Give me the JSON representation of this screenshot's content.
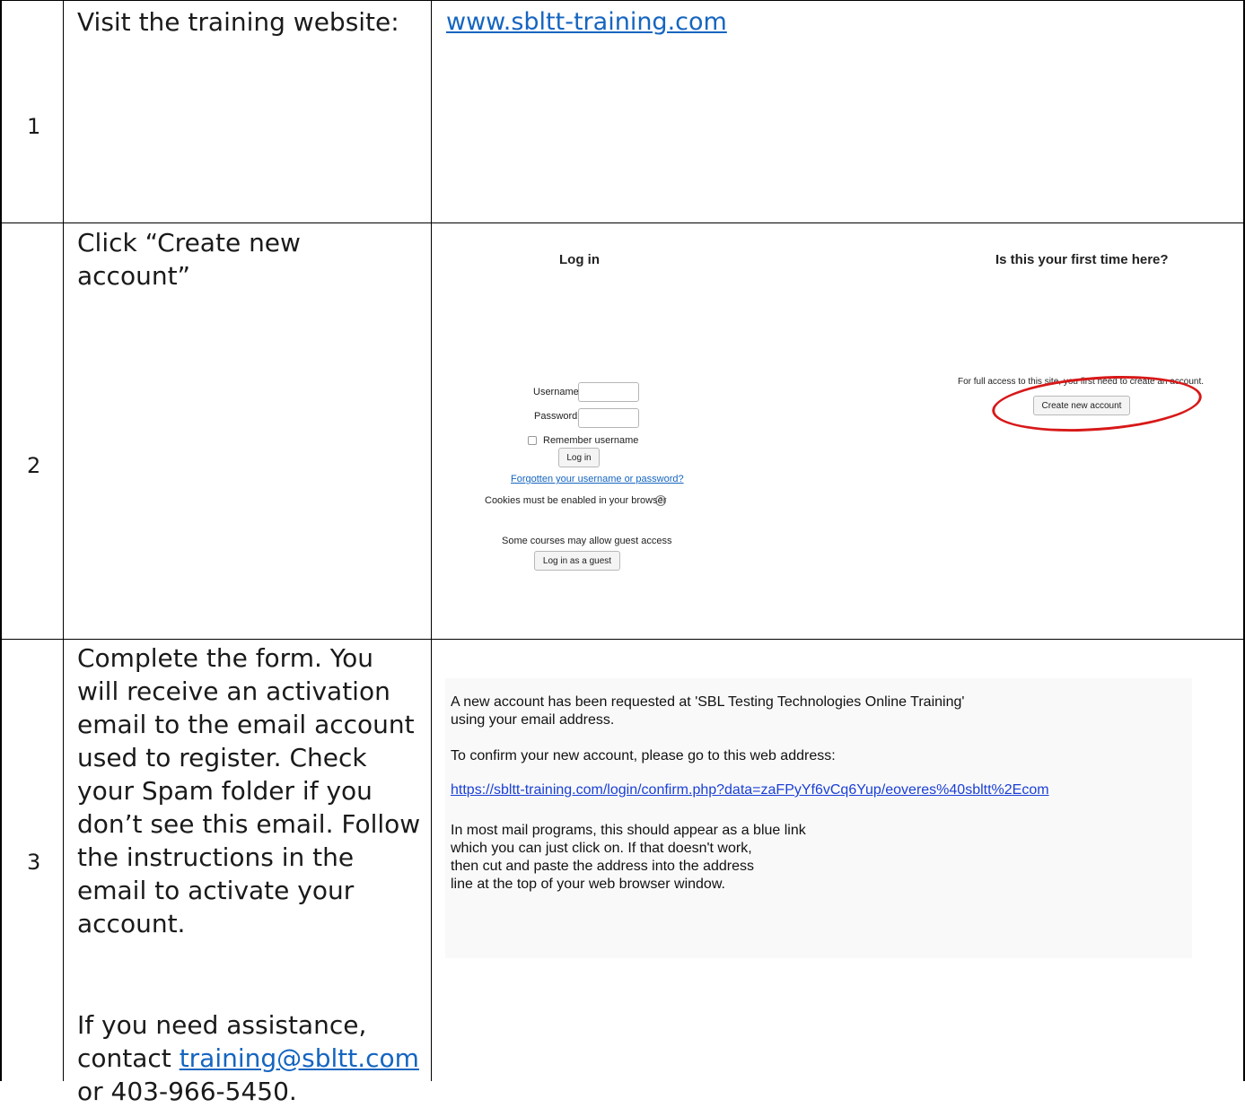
{
  "rows": [
    {
      "number": "1",
      "instruction": "Visit the training website:",
      "link": "www.sbltt-training.com"
    },
    {
      "number": "2",
      "instruction": "Click “Create new account”",
      "screenshot": {
        "login_title": "Log in",
        "username_label": "Username",
        "password_label": "Password",
        "remember_label": "Remember username",
        "login_button": "Log in",
        "forgot_link": "Forgotten your username or password?",
        "cookies_text": "Cookies must be enabled in your browser",
        "guest_text": "Some courses may allow guest access",
        "guest_button": "Log in as a guest",
        "first_time_title": "Is this your first time here?",
        "full_access_text": "For full access to this site, you first need to create an account.",
        "create_account_button": "Create new account",
        "highlight_color": "#d81818"
      }
    },
    {
      "number": "3",
      "instruction": "Complete the form. You will receive an activation email to the email account used to register. Check your Spam folder if you don’t see this email. Follow the instructions in the email to activate your account.",
      "assist_prefix": "If you need assistance, contact ",
      "assist_email": "training@sbltt.com",
      "assist_suffix": " or 403-966-5450.",
      "email": {
        "line1": "A new account has been requested at 'SBL Testing Technologies Online Training'",
        "line2": "using your email address.",
        "line3": "To confirm your new account, please go to this web address:",
        "confirm_link": "https://sbltt-training.com/login/confirm.php?data=zaFPyYf6vCq6Yup/eoveres%40sbltt%2Ecom",
        "line4": "In most mail programs, this should appear as a blue link",
        "line5": "which you can just click on. If that doesn't work,",
        "line6": "then cut and paste the address into the address",
        "line7": "line at the top of your web browser window."
      }
    }
  ]
}
